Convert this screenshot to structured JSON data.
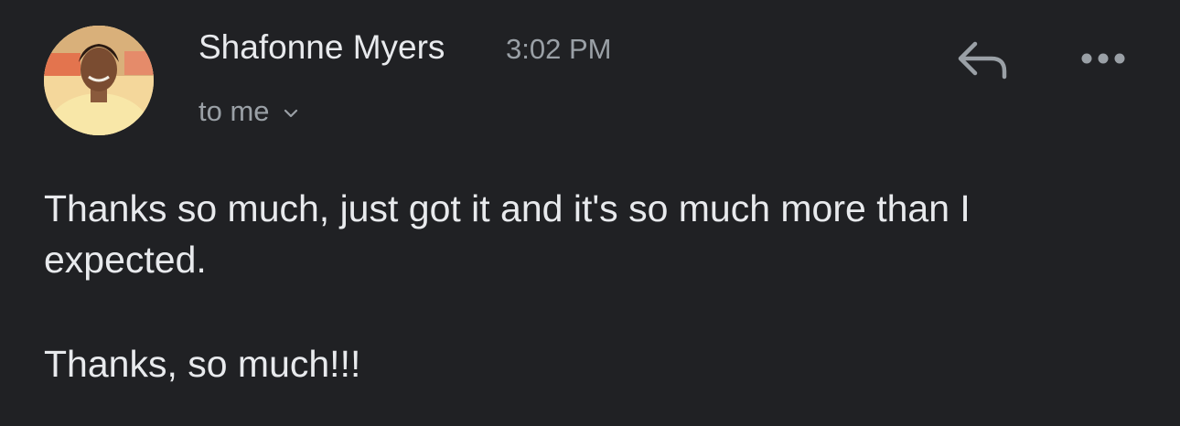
{
  "message": {
    "sender_name": "Shafonne Myers",
    "time": "3:02 PM",
    "recipient_label": "to me",
    "body": {
      "paragraph_1": "Thanks so much, just got it and it's so much more than I expected.",
      "paragraph_2": "Thanks, so much!!!"
    }
  },
  "icons": {
    "avatar": "avatar-photo",
    "recipient_toggle": "chevron-down-icon",
    "reply": "reply-icon",
    "more": "more-horizontal-icon"
  },
  "colors": {
    "background": "#202124",
    "primary_text": "#e8eaed",
    "secondary_text": "#9aa0a6"
  }
}
